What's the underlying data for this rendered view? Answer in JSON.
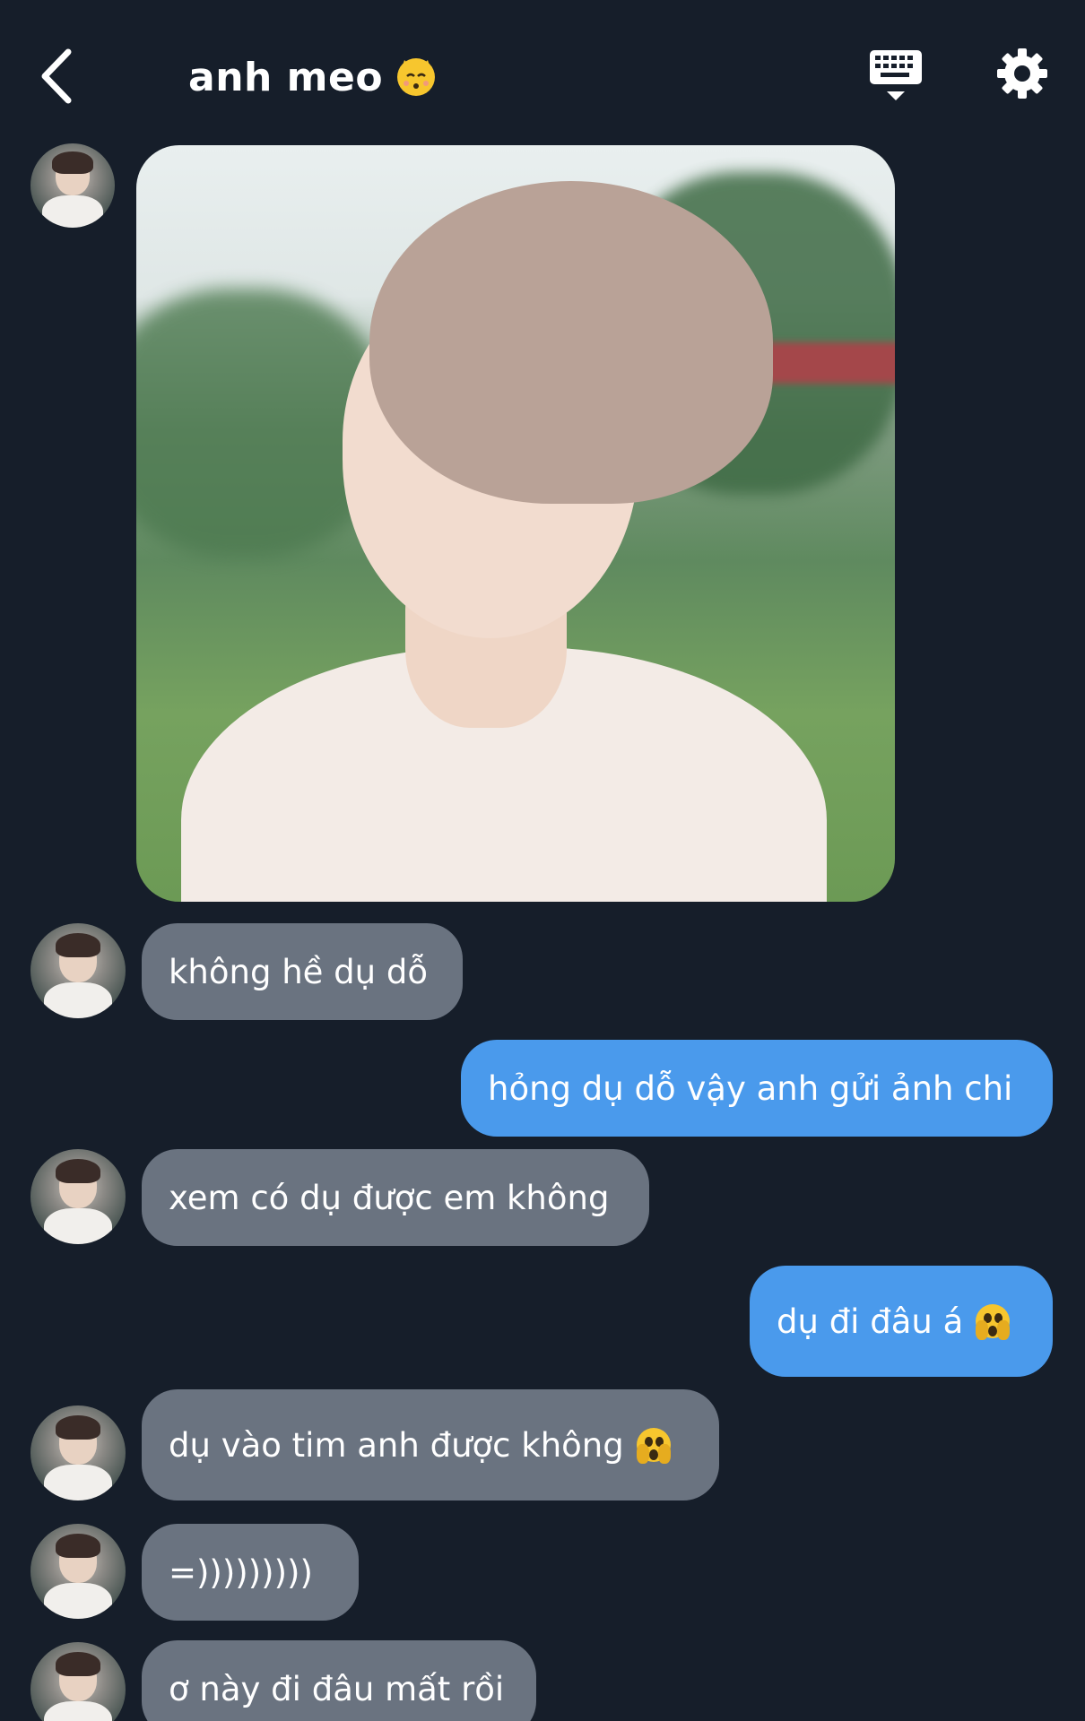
{
  "header": {
    "title": "anh meo",
    "title_emoji": "kissing-cat-emoji",
    "back_icon": "chevron-left-icon",
    "keyboard_icon": "keyboard-icon",
    "settings_icon": "gear-icon"
  },
  "messages": [
    {
      "from": "them",
      "type": "image",
      "description_icon": "photo"
    },
    {
      "from": "them",
      "text": "không hề dụ dỗ"
    },
    {
      "from": "me",
      "text": "hỏng dụ dỗ vậy anh gửi ảnh chi"
    },
    {
      "from": "them",
      "text": "xem có dụ được em không"
    },
    {
      "from": "me",
      "text": "dụ đi đâu á",
      "emoji": "hand-over-mouth-emoji"
    },
    {
      "from": "them",
      "text": "dụ vào tim anh được không",
      "emoji": "hand-over-mouth-emoji"
    },
    {
      "from": "them",
      "text": "=)))))))))"
    },
    {
      "from": "them",
      "text": "ơ này đi đâu mất rồi"
    }
  ],
  "colors": {
    "background": "#161e2a",
    "incoming_bubble": "#6a7380",
    "outgoing_bubble": "#4a9aec",
    "text": "#ffffff"
  }
}
